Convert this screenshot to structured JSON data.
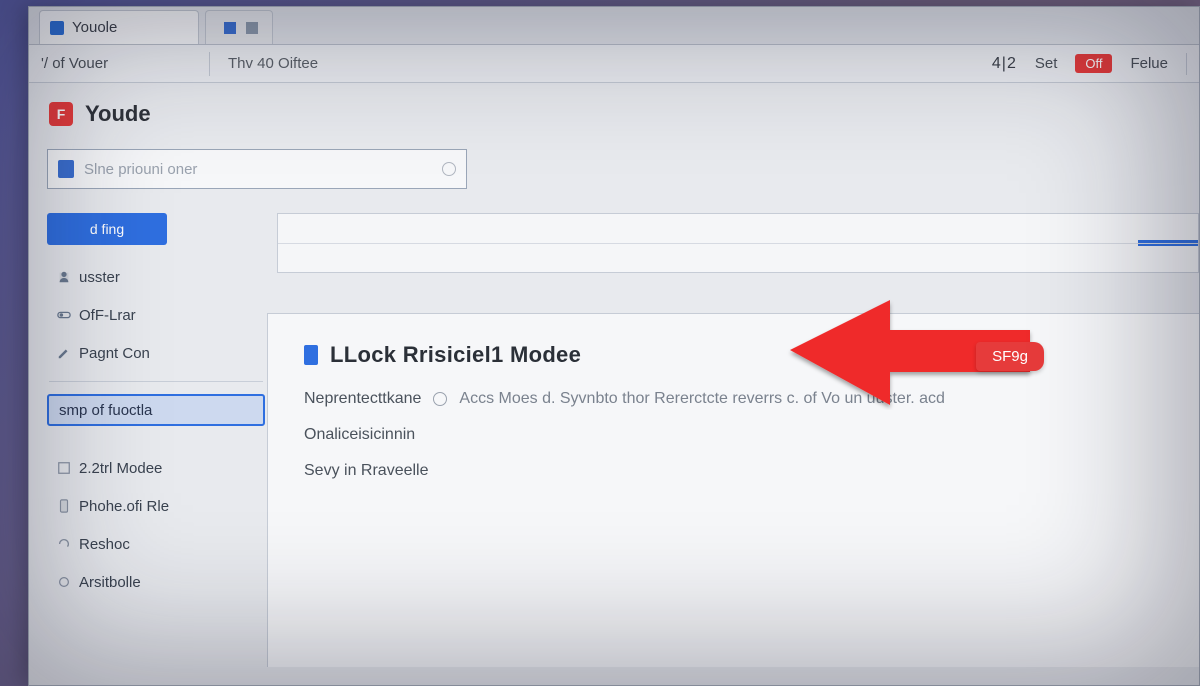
{
  "tabs": {
    "active": {
      "label": "Youole"
    },
    "secondary": {
      "label": ""
    }
  },
  "addressbar": {
    "left_label": "'/ of Vouer",
    "mid_label": "Thv 40 Oiftee",
    "count": "4|2",
    "set_label": "Set",
    "off_label": "Off",
    "feue_label": "Felue"
  },
  "brand": {
    "title": "Youde",
    "icon_glyph": "F"
  },
  "search": {
    "placeholder": "Slne priouni oner",
    "value": ""
  },
  "sidebar": {
    "primary_label": "d fing",
    "items": [
      {
        "label": "usster",
        "icon": "user-icon"
      },
      {
        "label": "OfF-Lrar",
        "icon": "toggle-icon"
      },
      {
        "label": "Pagnt Con",
        "icon": "paint-icon"
      }
    ],
    "selected": {
      "label": "smp of fuoctla"
    },
    "lower": [
      {
        "label": "2.2trl Modee",
        "icon": "mode-icon"
      },
      {
        "label": "Phohe.ofi Rle",
        "icon": "phone-icon"
      },
      {
        "label": "Reshoc",
        "icon": "refresh-icon"
      },
      {
        "label": "Arsitbolle",
        "icon": "misc-icon"
      }
    ]
  },
  "dialog": {
    "title": "LLock Rrisiciel1  Modee",
    "line1_a": "Neprentecttkane",
    "line1_b": "Accs Moes d. Syvnbto thor Rererctcte reverrs c. of Vo un uuster. acd",
    "line2": "Onaliceisicinnin",
    "line3": "Sevy in Rraveelle"
  },
  "arrow": {
    "badge": "SF9g"
  }
}
